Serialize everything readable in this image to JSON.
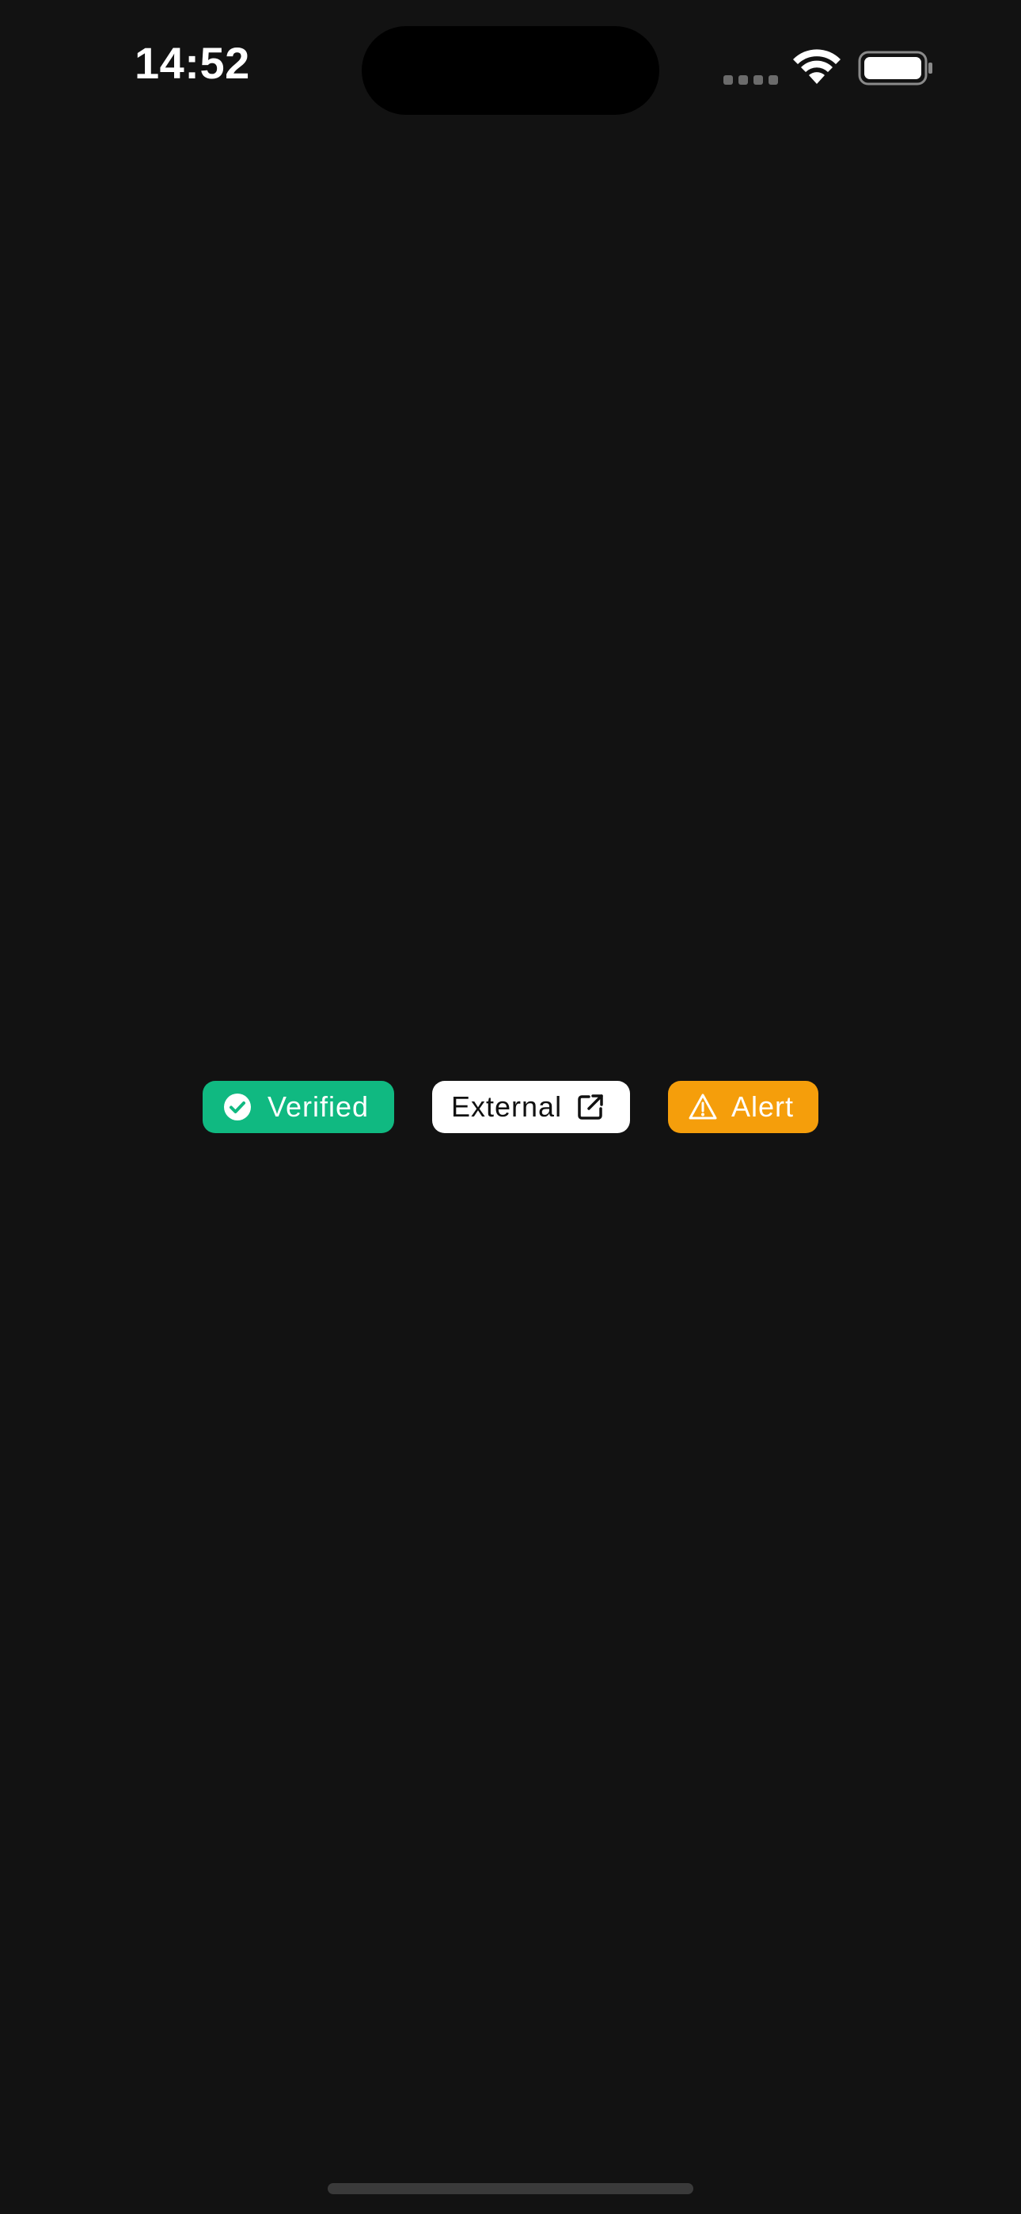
{
  "status_bar": {
    "time": "14:52",
    "wifi_icon": "wifi-icon",
    "battery_icon": "battery-icon",
    "signal_icon": "cellular-signal-icon"
  },
  "badges": [
    {
      "label": "Verified",
      "icon": "check-circle-icon",
      "bg": "#10b981",
      "fg": "#ffffff"
    },
    {
      "label": "External",
      "icon": "external-link-icon",
      "bg": "#ffffff",
      "fg": "#111111"
    },
    {
      "label": "Alert",
      "icon": "warning-triangle-icon",
      "bg": "#f59e0b",
      "fg": "#ffffff"
    }
  ],
  "colors": {
    "background": "#121212",
    "home_indicator": "#3a3a3a"
  }
}
